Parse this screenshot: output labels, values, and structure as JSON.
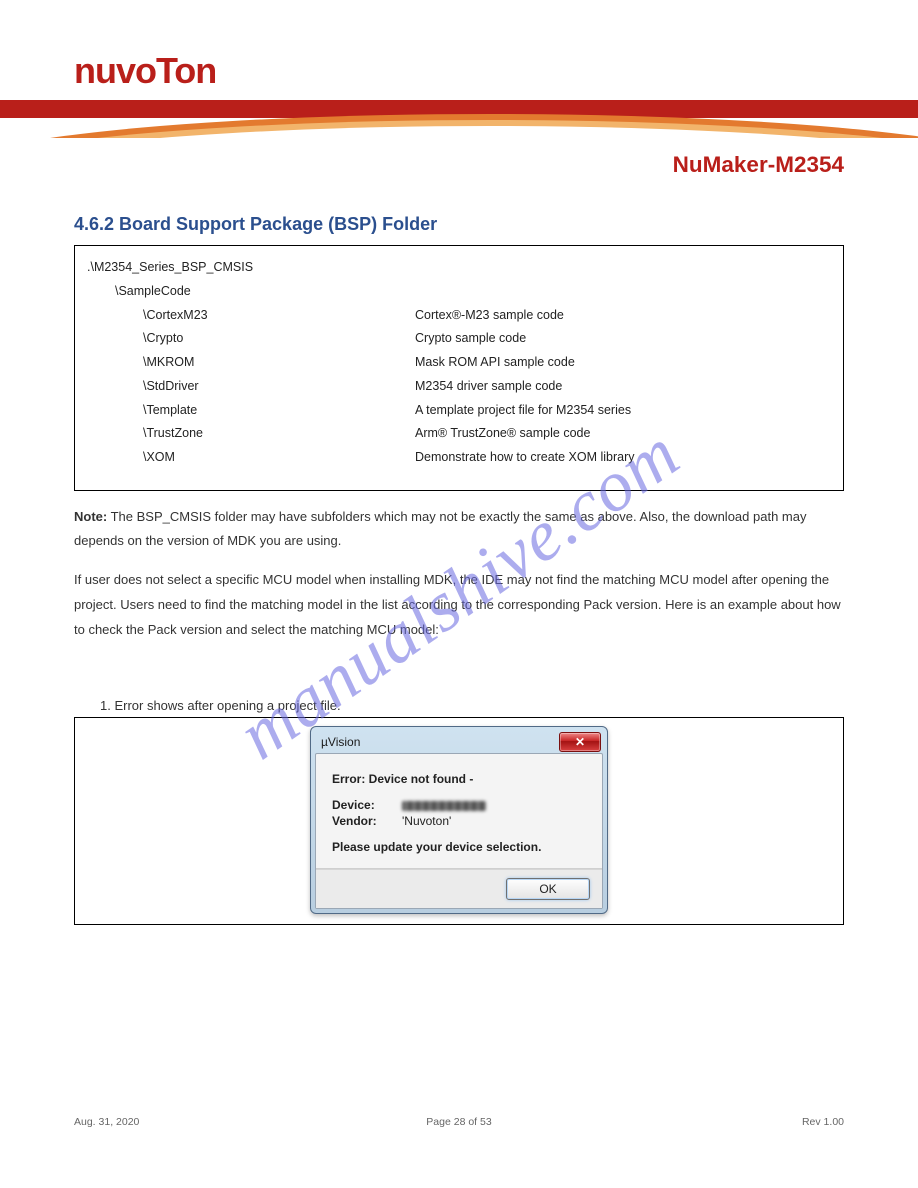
{
  "logo_text": "nuvoTon",
  "doc_title": "NuMaker-M2354",
  "watermark": "manualshive.com",
  "section_heading": "4.6.2 Board Support Package (BSP) Folder",
  "directory": {
    "root": {
      "path": ".\\M2354_Series_BSP_CMSIS",
      "desc": ""
    },
    "sub": {
      "path": "\\SampleCode",
      "desc": ""
    },
    "leaves": [
      {
        "path": "\\CortexM23",
        "desc": "Cortex®-M23 sample code"
      },
      {
        "path": "\\Crypto",
        "desc": "Crypto sample code"
      },
      {
        "path": "\\MKROM",
        "desc": "Mask ROM API sample code"
      },
      {
        "path": "\\StdDriver",
        "desc": "M2354 driver sample code"
      },
      {
        "path": "\\Template",
        "desc": "A template project file for M2354 series"
      },
      {
        "path": "\\TrustZone",
        "desc": "Arm® TrustZone® sample code"
      },
      {
        "path": "\\XOM",
        "desc": "Demonstrate how to create XOM library"
      }
    ]
  },
  "note": {
    "lead": "Note:",
    "line1": " The BSP_CMSIS folder may have subfolders which may not be exactly the same as above. Also, the download path may depends on the version of MDK you are using.",
    "line2": "If user does not select a specific MCU model when installing MDK, the IDE may not find the matching MCU model after opening the project. Users need to find the matching model in the list according to the corresponding Pack version. Here is an example about how to check the Pack version and select the matching MCU model:"
  },
  "steplabel": "1.    Error shows after opening a project file.",
  "dialog": {
    "title": "µVision",
    "err_line": "Error: Device not found -",
    "device_label": "Device:",
    "vendor_label": "Vendor:",
    "vendor_value": "'Nuvoton'",
    "update_line": "Please update your device selection.",
    "ok": "OK"
  },
  "footer": {
    "left": "Aug. 31, 2020",
    "center": "Page 28 of 53",
    "right": "Rev 1.00"
  }
}
